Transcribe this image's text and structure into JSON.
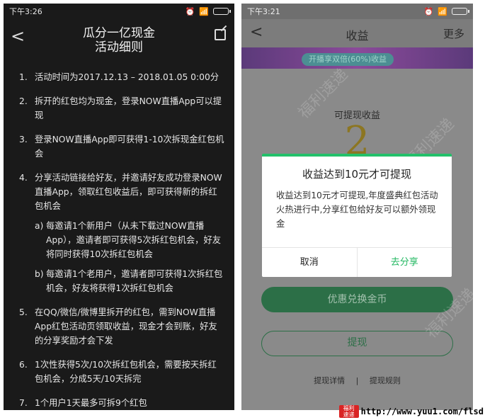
{
  "left": {
    "status": {
      "time": "下午3:26"
    },
    "title_line1": "瓜分一亿现金",
    "title_line2": "活动细则",
    "rules": [
      {
        "num": "1.",
        "text": "活动时间为2017.12.13 – 2018.01.05 0:00分"
      },
      {
        "num": "2.",
        "text": "拆开的红包均为现金，登录NOW直播App可以提现"
      },
      {
        "num": "3.",
        "text": "登录NOW直播App即可获得1-10次拆现金红包机会"
      },
      {
        "num": "4.",
        "text": "分享活动链接给好友，并邀请好友成功登录NOW直播App，领取红包收益后，即可获得新的拆红包机会"
      },
      {
        "num": "5.",
        "text": "在QQ/微信/微博里拆开的红包，需到NOW直播App红包活动页领取收益，现金才会到账，好友的分享奖励才会下发"
      },
      {
        "num": "6.",
        "text": "1次性获得5次/10次拆红包机会，需要按天拆红包机会，分成5天/10天拆完"
      },
      {
        "num": "7.",
        "text": "1个用户1天最多可拆9个红包"
      }
    ],
    "subrules": [
      {
        "num": "a)",
        "text": "每邀请1个新用户（从未下载过NOW直播App），邀请者即可获得5次拆红包机会，好友将同时获得10次拆红包机会"
      },
      {
        "num": "b)",
        "text": "每邀请1个老用户，邀请者即可获得1次拆红包机会，好友将获得1次拆红包机会"
      }
    ]
  },
  "right": {
    "status": {
      "time": "下午3:21"
    },
    "title": "收益",
    "more": "更多",
    "banner_text": "开播享双倍(60%)收益",
    "earn_label": "可提现收益",
    "big_num": "2",
    "buttons": {
      "exchange": "优惠兑换金币",
      "withdraw": "提现"
    },
    "links": {
      "detail": "提现详情",
      "sep": "|",
      "rules": "提现规则"
    },
    "dialog": {
      "title": "收益达到10元才可提现",
      "body": "收益达到10元才可提现,年度盛典红包活动火热进行中,分享红包给好友可以额外领现金",
      "cancel": "取消",
      "share": "去分享"
    },
    "watermark": "福利速递"
  },
  "footer": {
    "logo_top": "福利",
    "logo_bottom": "速递",
    "url": "http://www.yuu1.com/flsd"
  },
  "icons": [
    "back-icon",
    "edit-icon",
    "wifi-icon",
    "signal-icon",
    "battery-icon"
  ]
}
